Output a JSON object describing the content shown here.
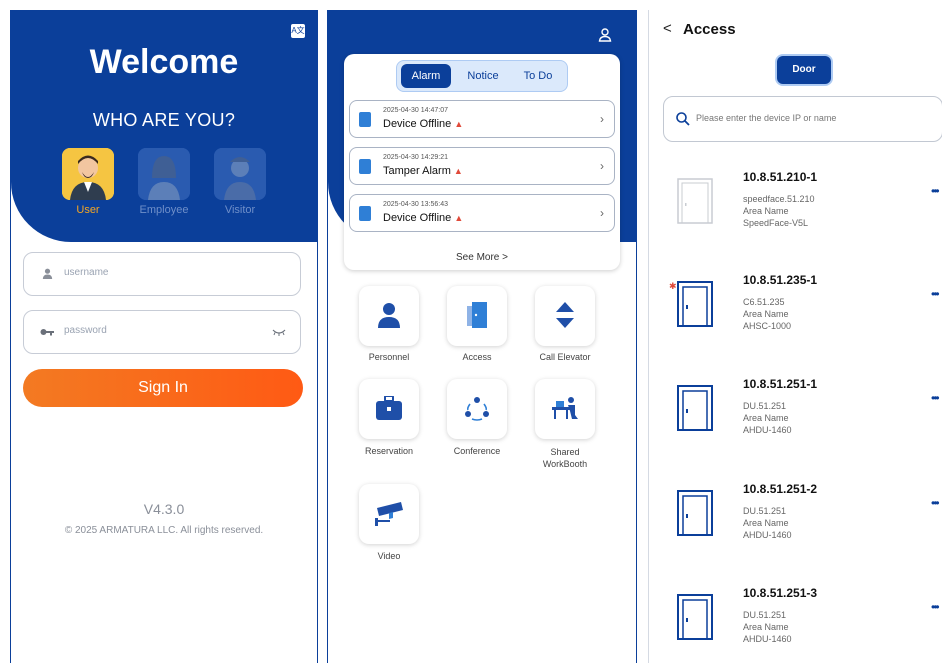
{
  "login": {
    "translate_label": "A文",
    "welcome": "Welcome",
    "who": "WHO ARE YOU?",
    "roles": [
      {
        "label": "User",
        "active": true
      },
      {
        "label": "Employee",
        "active": false
      },
      {
        "label": "Visitor",
        "active": false
      }
    ],
    "username_placeholder": "username",
    "password_placeholder": "password",
    "sign_in": "Sign In",
    "version": "V4.3.0",
    "copyright": "© 2025 ARMATURA LLC. All rights reserved."
  },
  "home": {
    "tabs": [
      "Alarm",
      "Notice",
      "To Do"
    ],
    "alarms": [
      {
        "datetime": "2025-04-30 14:47:07",
        "title": "Device Offline"
      },
      {
        "datetime": "2025-04-30 14:29:21",
        "title": "Tamper Alarm"
      },
      {
        "datetime": "2025-04-30 13:56:43",
        "title": "Device Offline"
      }
    ],
    "see_more": "See More >",
    "menu": [
      {
        "label": "Personnel",
        "icon": "person-icon"
      },
      {
        "label": "Access",
        "icon": "door-icon"
      },
      {
        "label": "Call Elevator",
        "icon": "elevator-icon"
      },
      {
        "label": "Reservation",
        "icon": "briefcase-icon"
      },
      {
        "label": "Conference",
        "icon": "conference-icon"
      },
      {
        "label": "Shared\nWorkBooth",
        "icon": "workbooth-icon"
      },
      {
        "label": "Video",
        "icon": "camera-icon"
      }
    ]
  },
  "access": {
    "back_label": "<",
    "title": "Access",
    "door_tab": "Door",
    "search_placeholder": "Please enter the device IP or name",
    "devices": [
      {
        "name": "10.8.51.210-1",
        "line1": "speedface.51.210",
        "line2": "Area Name",
        "line3": "SpeedFace-V5L",
        "status": "offline"
      },
      {
        "name": "10.8.51.235-1",
        "line1": "C6.51.235",
        "line2": "Area Name",
        "line3": "AHSC-1000",
        "status": "alarm"
      },
      {
        "name": "10.8.51.251-1",
        "line1": "DU.51.251",
        "line2": "Area Name",
        "line3": "AHDU-1460",
        "status": "online"
      },
      {
        "name": "10.8.51.251-2",
        "line1": "DU.51.251",
        "line2": "Area Name",
        "line3": "AHDU-1460",
        "status": "online"
      },
      {
        "name": "10.8.51.251-3",
        "line1": "DU.51.251",
        "line2": "Area Name",
        "line3": "AHDU-1460",
        "status": "online"
      }
    ]
  },
  "colors": {
    "primary": "#0b3f9a",
    "accent": "#f37a22",
    "active_role": "#f5a623"
  }
}
